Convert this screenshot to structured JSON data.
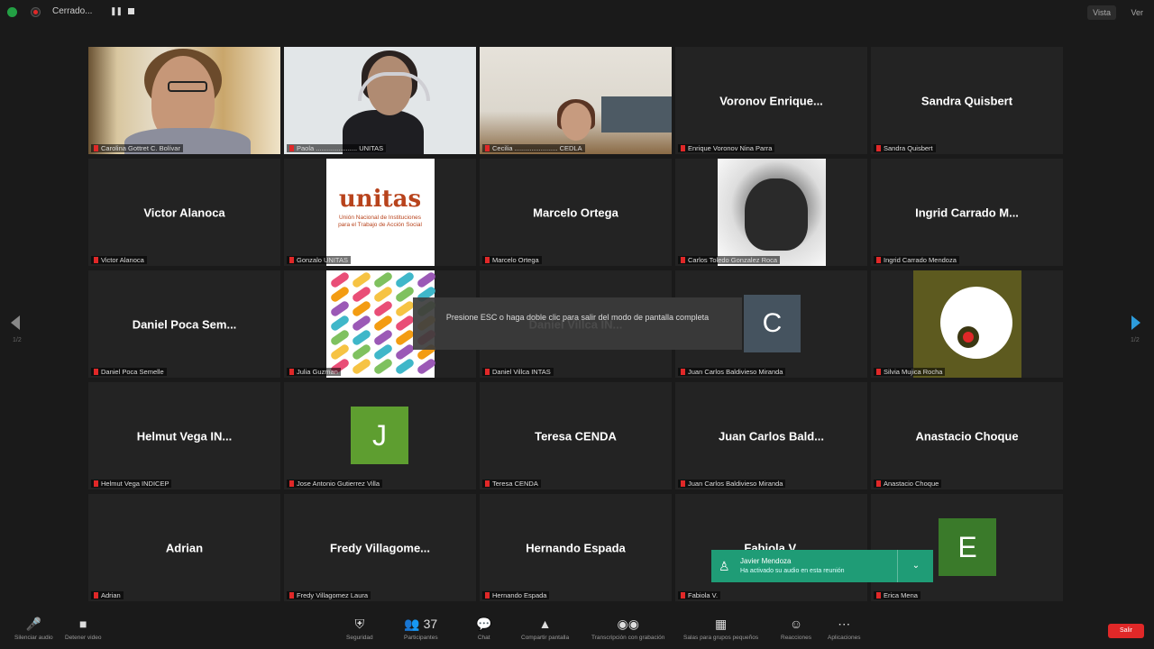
{
  "topbar": {
    "title": "Cerrado...",
    "view_label": "Vista",
    "grid_label": "Ver"
  },
  "tiles": [
    {
      "type": "video",
      "video": "v-books",
      "label": "Carolina Gottret C. Bolívar",
      "active": true
    },
    {
      "type": "video",
      "video": "v-office",
      "label": "Paola ...................... UNITAS"
    },
    {
      "type": "video",
      "video": "v-room",
      "label": "Cecilia ....................... CEDLA"
    },
    {
      "type": "name",
      "name": "Voronov  Enrique...",
      "label": "Enrique Voronov Nina Parra"
    },
    {
      "type": "name",
      "name": "Sandra Quisbert",
      "label": "Sandra Quisbert"
    },
    {
      "type": "name",
      "name": "Victor Alanoca",
      "label": "Victor Alanoca"
    },
    {
      "type": "image",
      "image": "unitas",
      "label": "Gonzalo UNITAS"
    },
    {
      "type": "name",
      "name": "Marcelo Ortega",
      "label": "Marcelo Ortega"
    },
    {
      "type": "image",
      "image": "bear",
      "label": "Carlos Toledo Gonzalez Roca"
    },
    {
      "type": "name",
      "name": "Ingrid Carrado M...",
      "label": "Ingrid Carrado Mendoza"
    },
    {
      "type": "name",
      "name": "Daniel  Poca  Sem...",
      "label": "Daniel Poca Semelle"
    },
    {
      "type": "image",
      "image": "pattern",
      "label": "Julia Guzman"
    },
    {
      "type": "name",
      "name": "Daniel Villca IN...",
      "label": "Daniel Villca INTAS"
    },
    {
      "type": "name",
      "name": "",
      "label": "Juan Carlos Baldivieso Miranda"
    },
    {
      "type": "image",
      "image": "spiral",
      "label": "Silvia Mujica Rocha"
    },
    {
      "type": "name",
      "name": "Helmut  Vega  IN...",
      "label": "Helmut Vega INDICEP"
    },
    {
      "type": "letter",
      "letter": "J",
      "letter_color": "#5e9e30",
      "label": "Jose Antonio Gutierrez Villa"
    },
    {
      "type": "name",
      "name": "Teresa    CENDA",
      "label": "Teresa CENDA"
    },
    {
      "type": "name",
      "name": "Juan Carlos Bald...",
      "label": "Juan Carlos Baldivieso Miranda"
    },
    {
      "type": "name",
      "name": "Anastacio Choque",
      "label": "Anastacio Choque"
    },
    {
      "type": "name",
      "name": "Adrian",
      "label": "Adrian"
    },
    {
      "type": "name",
      "name": "Fredy  Villagome...",
      "label": "Fredy Villagomez Laura"
    },
    {
      "type": "name",
      "name": "Hernando Espada",
      "label": "Hernando Espada"
    },
    {
      "type": "name",
      "name": "Fabiola V.",
      "label": "Fabiola V."
    },
    {
      "type": "name",
      "name": "",
      "label": "Erica Mena"
    }
  ],
  "nav": {
    "left_page": "1/2",
    "right_page": "1/2"
  },
  "tooltip": {
    "text": "Presione ESC o haga doble clic para salir del modo de pantalla completa"
  },
  "c_avatar": {
    "letter": "C"
  },
  "notification": {
    "title": "Javier Mendoza",
    "subtitle": "Ha activado su audio en esta reunión",
    "dropdown": "⌄"
  },
  "e_avatar": {
    "letter": "E",
    "color": "#3a7a2a"
  },
  "toolbar": {
    "items": [
      {
        "icon": "🎤",
        "label": "Silenciar audio",
        "name": "mute-button"
      },
      {
        "icon": "■",
        "label": "Detener video",
        "name": "video-button"
      },
      {
        "icon": "⛨",
        "label": "Seguridad",
        "name": "security-button"
      },
      {
        "icon": "👥",
        "label": "Participantes",
        "name": "participants-button",
        "count": "37"
      },
      {
        "icon": "💬",
        "label": "Chat",
        "name": "chat-button"
      },
      {
        "icon": "▲",
        "label": "Compartir pantalla",
        "name": "share-button"
      },
      {
        "icon": "◉◉",
        "label": "Transcripción con grabación",
        "name": "record-button"
      },
      {
        "icon": "▦",
        "label": "Salas para grupos pequeños",
        "name": "breakout-button"
      },
      {
        "icon": "☺",
        "label": "Reacciones",
        "name": "reactions-button"
      },
      {
        "icon": "⋯",
        "label": "Aplicaciones",
        "name": "apps-button"
      }
    ],
    "end_label": "Salir"
  }
}
